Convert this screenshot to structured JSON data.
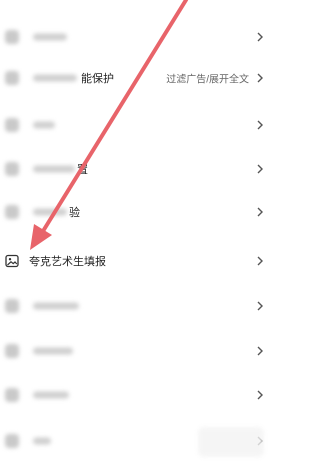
{
  "settings": {
    "rows": [
      {
        "label": "",
        "value": ""
      },
      {
        "label": "能保护",
        "value": "过滤广告/展开全文"
      },
      {
        "label": "",
        "value": ""
      },
      {
        "label": "置",
        "value": ""
      },
      {
        "label": "验",
        "value": ""
      },
      {
        "label": "夸克艺术生填报",
        "value": ""
      },
      {
        "label": "",
        "value": ""
      },
      {
        "label": "",
        "value": ""
      },
      {
        "label": "",
        "value": ""
      },
      {
        "label": "",
        "value": ""
      }
    ]
  },
  "icons": {
    "chevron": "chevron-right-icon",
    "highlighted_row_icon": "image-icon"
  },
  "colors": {
    "arrow": "#e8646a",
    "chevron": "#555555",
    "blur": "#cfcfcf"
  }
}
